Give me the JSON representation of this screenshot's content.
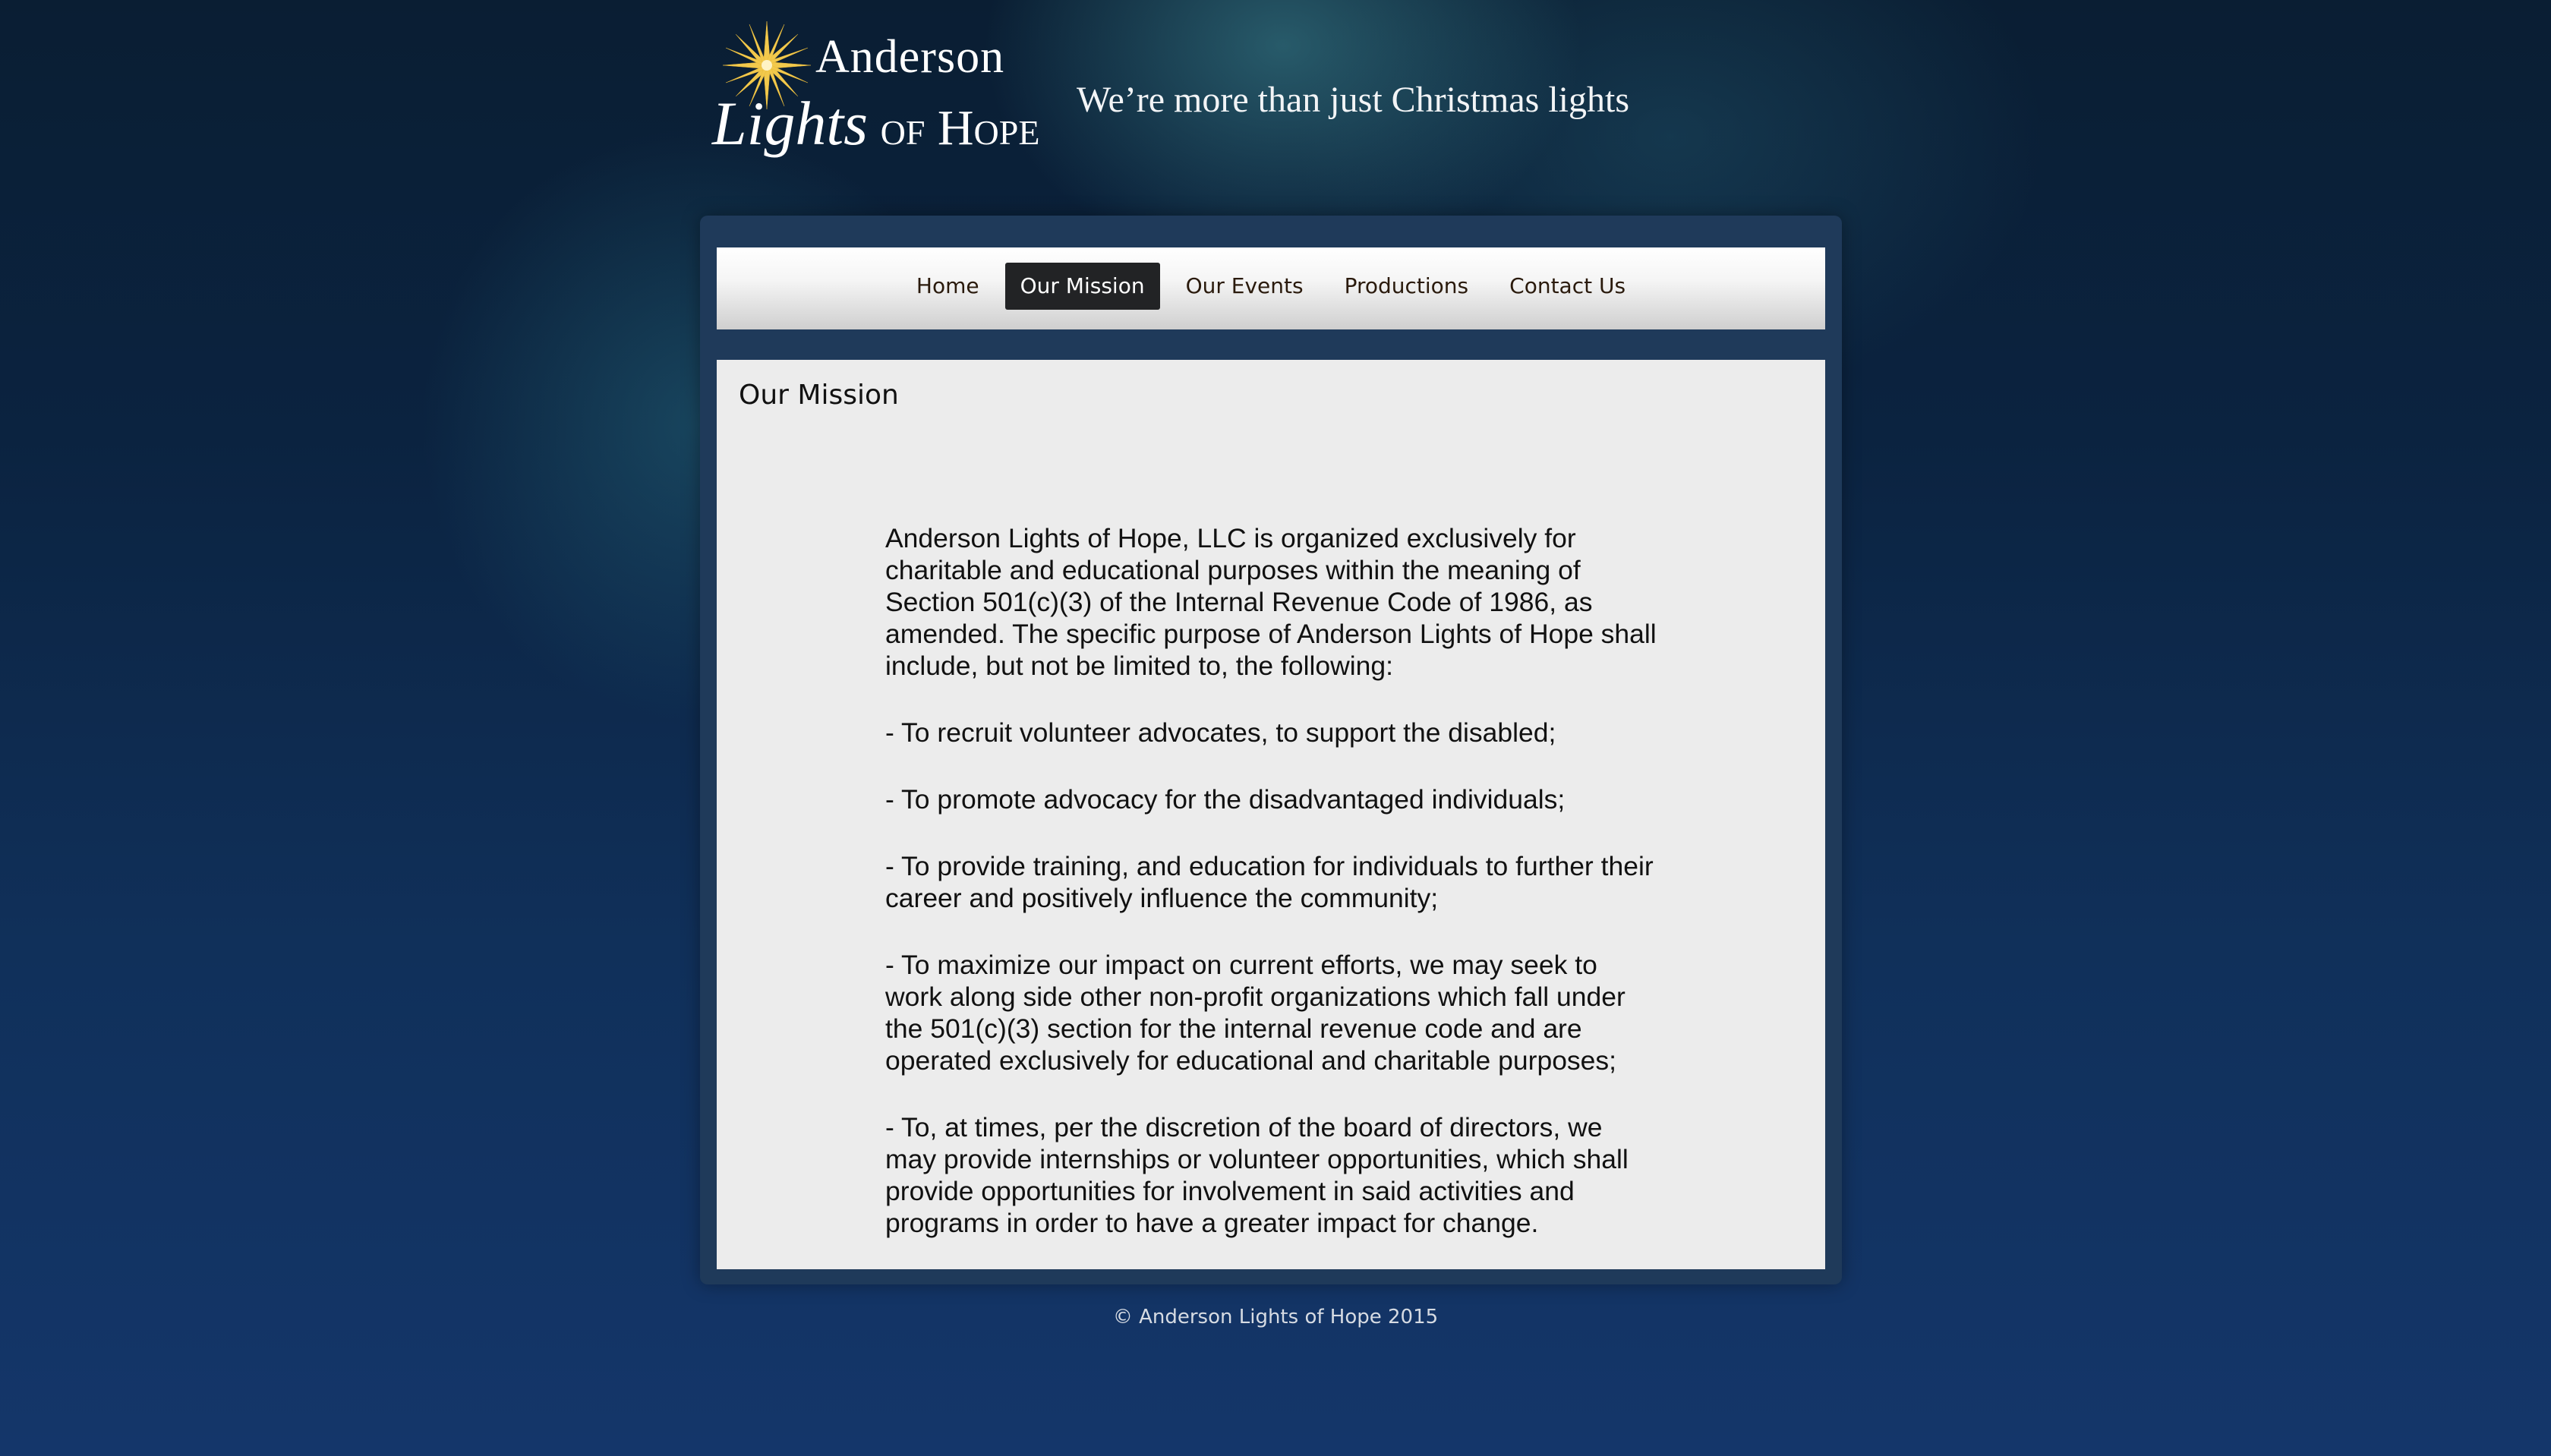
{
  "header": {
    "logo": {
      "line1": "Anderson",
      "line2_script": "Lights",
      "line2_rest": "of Hope",
      "star_color": "#f2c94c"
    },
    "tagline": "We’re more than just Christmas lights"
  },
  "nav": {
    "items": [
      {
        "label": "Home",
        "active": false
      },
      {
        "label": "Our Mission",
        "active": true
      },
      {
        "label": "Our Events",
        "active": false
      },
      {
        "label": "Productions",
        "active": false
      },
      {
        "label": "Contact Us",
        "active": false
      }
    ]
  },
  "main": {
    "title": "Our Mission",
    "paragraphs": [
      "Anderson Lights of Hope, LLC is organized exclusively for charitable and educational purposes within the meaning of Section 501(c)(3) of the Internal Revenue Code of 1986, as amended. The specific purpose of Anderson Lights of Hope shall include, but not be limited to, the following:",
      "- To recruit volunteer advocates, to support the disabled;",
      "- To promote advocacy for the disadvantaged individuals;",
      "- To provide training, and education for individuals to further their career and positively influence the community;",
      "- To maximize our impact on current efforts, we may seek to work along side other non-profit organizations which fall under the 501(c)(3) section for the internal revenue code and are operated exclusively for educational and charitable purposes;",
      "- To, at times, per the discretion of the board of directors, we may provide internships or volunteer opportunities, which shall provide opportunities for involvement in said activities and programs in order to have a greater impact for change."
    ]
  },
  "footer": {
    "copyright": "© Anderson Lights of Hope 2015"
  }
}
